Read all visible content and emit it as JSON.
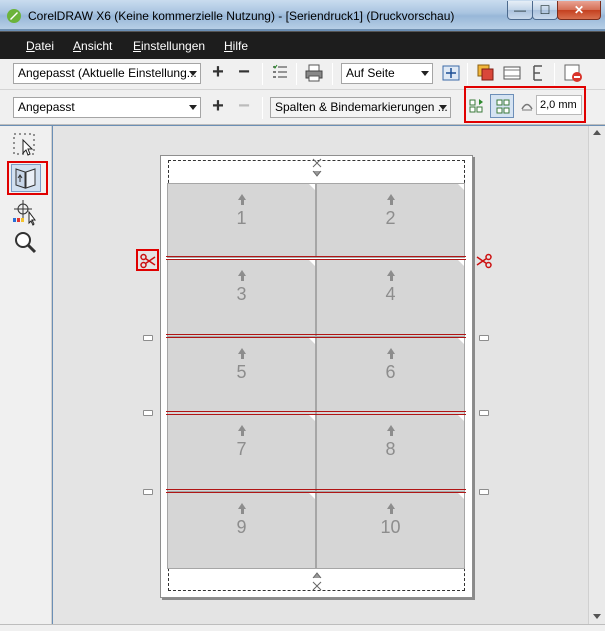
{
  "window": {
    "title": "CorelDRAW X6 (Keine kommerzielle Nutzung) - [Seriendruck1] (Druckvorschau)",
    "minimize_icon": "minimize-icon",
    "maximize_icon": "maximize-icon",
    "close_icon": "close-icon",
    "min_glyph": "—",
    "max_glyph": "☐",
    "close_glyph": "✕"
  },
  "menu": {
    "items": [
      {
        "label": "Datei",
        "underline": "D"
      },
      {
        "label": "Ansicht",
        "underline": "A"
      },
      {
        "label": "Einstellungen",
        "underline": "E"
      },
      {
        "label": "Hilfe",
        "underline": "H"
      }
    ]
  },
  "toolbar1": {
    "preset_value": "Angepasst (Aktuelle Einstellung...",
    "add_glyph": "+",
    "remove_glyph": "−",
    "zoom_value": "Auf Seite"
  },
  "toolbar2": {
    "layout_value": "Angepasst",
    "add_glyph": "+",
    "remove_glyph": "−",
    "marks_value": "Spalten & Bindemarkierungen ...",
    "gutter_value": "2,0 mm"
  },
  "layout": {
    "cells": [
      "1",
      "2",
      "3",
      "4",
      "5",
      "6",
      "7",
      "8",
      "9",
      "10"
    ]
  },
  "colors": {
    "cut_line": "#b01515",
    "highlight": "#e00000",
    "cell_fill": "#d6d6d6"
  }
}
